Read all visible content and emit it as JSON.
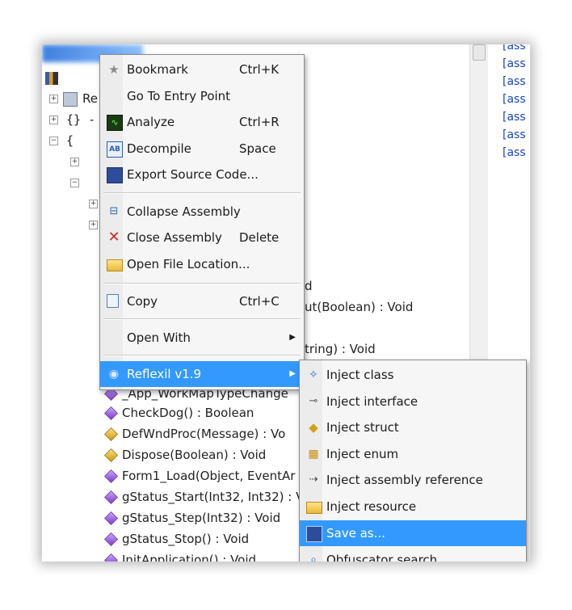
{
  "tree": {
    "root_label": "Re",
    "braces_1": "{} -",
    "braces_2": "{",
    "members": [
      "_App_WorkMapTypeChange",
      "CheckDog() : Boolean",
      "DefWndProc(Message) : Vo",
      "Dispose(Boolean) : Void",
      "Form1_Load(Object, EventAr",
      "gStatus_Start(Int32, Int32) : V",
      "gStatus_Step(Int32) : Void",
      "gStatus_Stop() : Void",
      "InitApplication() : Void"
    ],
    "partial_right": [
      "d",
      "ut(Boolean) : Void",
      "tring) : Void"
    ]
  },
  "attributes": [
    "[ass",
    "[ass",
    "[ass",
    "[ass",
    "[ass",
    "[ass",
    "[ass"
  ],
  "context_menu": {
    "items": [
      {
        "label": "Bookmark",
        "shortcut": "Ctrl+K",
        "icon": "star-icon"
      },
      {
        "label": "Go To Entry Point",
        "shortcut": "",
        "icon": ""
      },
      {
        "label": "Analyze",
        "shortcut": "Ctrl+R",
        "icon": "analyze-icon"
      },
      {
        "label": "Decompile",
        "shortcut": "Space",
        "icon": "decompile-icon"
      },
      {
        "label": "Export Source Code...",
        "shortcut": "",
        "icon": "save-icon"
      },
      {
        "label": "Collapse Assembly",
        "shortcut": "",
        "icon": "collapse-icon"
      },
      {
        "label": "Close Assembly",
        "shortcut": "Delete",
        "icon": "close-icon"
      },
      {
        "label": "Open File Location...",
        "shortcut": "",
        "icon": "folder-icon"
      },
      {
        "label": "Copy",
        "shortcut": "Ctrl+C",
        "icon": "copy-icon"
      },
      {
        "label": "Open With",
        "shortcut": "",
        "icon": ""
      },
      {
        "label": "Reflexil v1.9",
        "shortcut": "",
        "icon": "reflexil-icon"
      }
    ]
  },
  "submenu": {
    "items": [
      {
        "label": "Inject class"
      },
      {
        "label": "Inject interface"
      },
      {
        "label": "Inject struct"
      },
      {
        "label": "Inject enum"
      },
      {
        "label": "Inject assembly reference"
      },
      {
        "label": "Inject resource"
      },
      {
        "label": "Save as..."
      },
      {
        "label": "Obfuscator search..."
      }
    ]
  },
  "colors": {
    "highlight": "#3399ff",
    "attribute_text": "#1a44c8"
  }
}
